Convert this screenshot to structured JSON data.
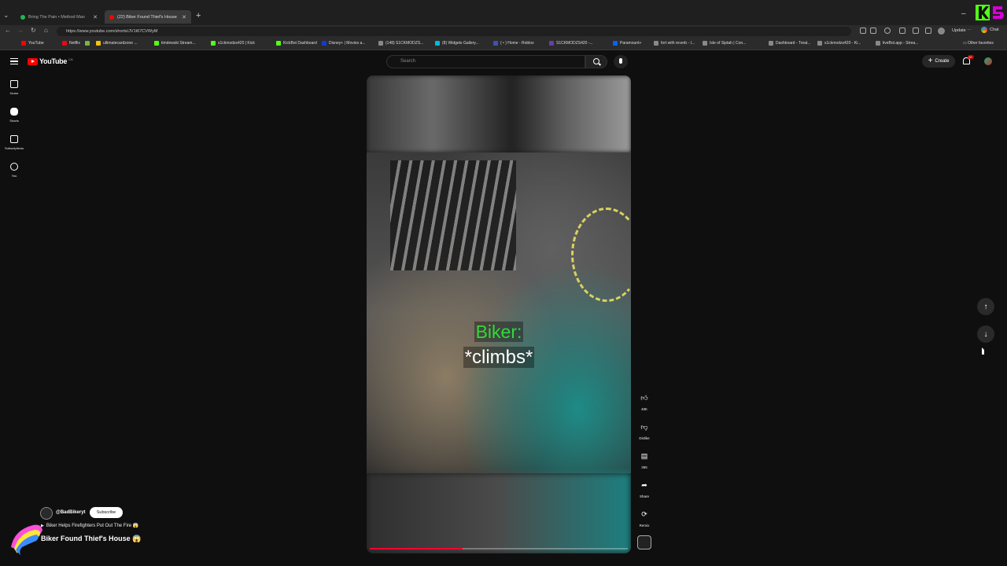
{
  "browser": {
    "tabs": [
      {
        "title": "Bring The Pain • Method Man",
        "favicon_color": "#1db954",
        "active": false
      },
      {
        "title": "(22) Biker Found Thief's House",
        "favicon_color": "#ff0000",
        "active": true
      }
    ],
    "new_tab": "+",
    "close_glyph": "✕",
    "url": "https://www.youtube.com/shorts/JV1t67CVWyM",
    "update_label": "Update",
    "chat_label": "Chat",
    "bookmarks": [
      {
        "label": "YouTube",
        "color": "#ff0000"
      },
      {
        "label": "Netflix",
        "color": "#e50914"
      },
      {
        "label": "",
        "color": "#7cb342"
      },
      {
        "label": "ultimatecardzone ...",
        "color": "#f4c20d"
      },
      {
        "label": "timdewski Stream...",
        "color": "#53fc18"
      },
      {
        "label": "s1ckmodzs420 | Kick",
        "color": "#53fc18"
      },
      {
        "label": "KickBot Dashboard",
        "color": "#53fc18"
      },
      {
        "label": "Disney+ | Movies a...",
        "color": "#113ccf"
      },
      {
        "label": "(148) S1CKMODZS...",
        "color": "#888888"
      },
      {
        "label": "(8) Widgets Gallery...",
        "color": "#00bcd4"
      },
      {
        "label": "( • ) Home - Roblox",
        "color": "#3f51b5"
      },
      {
        "label": "S1CKMODZS420 -...",
        "color": "#6441a5"
      },
      {
        "label": "Paramount+",
        "color": "#0064ff"
      },
      {
        "label": "fort with reverb - I...",
        "color": "#888888"
      },
      {
        "label": "Isle of Siptah | Con...",
        "color": "#888888"
      },
      {
        "label": "Dashboard - Treat...",
        "color": "#888888"
      },
      {
        "label": "s1ckmodzs420 - Ki...",
        "color": "#888888"
      },
      {
        "label": "liveBot.app - Strea...",
        "color": "#888888"
      }
    ],
    "other_favorites": "Other favorites"
  },
  "youtube": {
    "logo_text": "YouTube",
    "country_code": "CA",
    "search_placeholder": "Search",
    "create_label": "Create",
    "notification_badge": "9+",
    "guide": [
      {
        "label": "Home",
        "icon": "home-icon"
      },
      {
        "label": "Shorts",
        "icon": "shorts-icon"
      },
      {
        "label": "Subscriptions",
        "icon": "subscriptions-icon"
      },
      {
        "label": "You",
        "icon": "you-icon"
      }
    ]
  },
  "short": {
    "caption_speaker": "Biker:",
    "caption_action": "*climbs*",
    "progress": 0.36,
    "actions": {
      "like_count": "48K",
      "dislike_label": "Dislike",
      "comment_count": "365",
      "share_label": "Share",
      "remix_label": "Remix"
    },
    "channel": "@BadBikeryt",
    "subscribe_label": "Subscribe",
    "related_title": "Biker Helps Firefighters Put Out The Fire 😱",
    "title": "Biker Found Thief's House 😱"
  },
  "colors": {
    "accent": "#ff0000",
    "caption_green": "#2edb3a",
    "progress": "#ff0033"
  }
}
